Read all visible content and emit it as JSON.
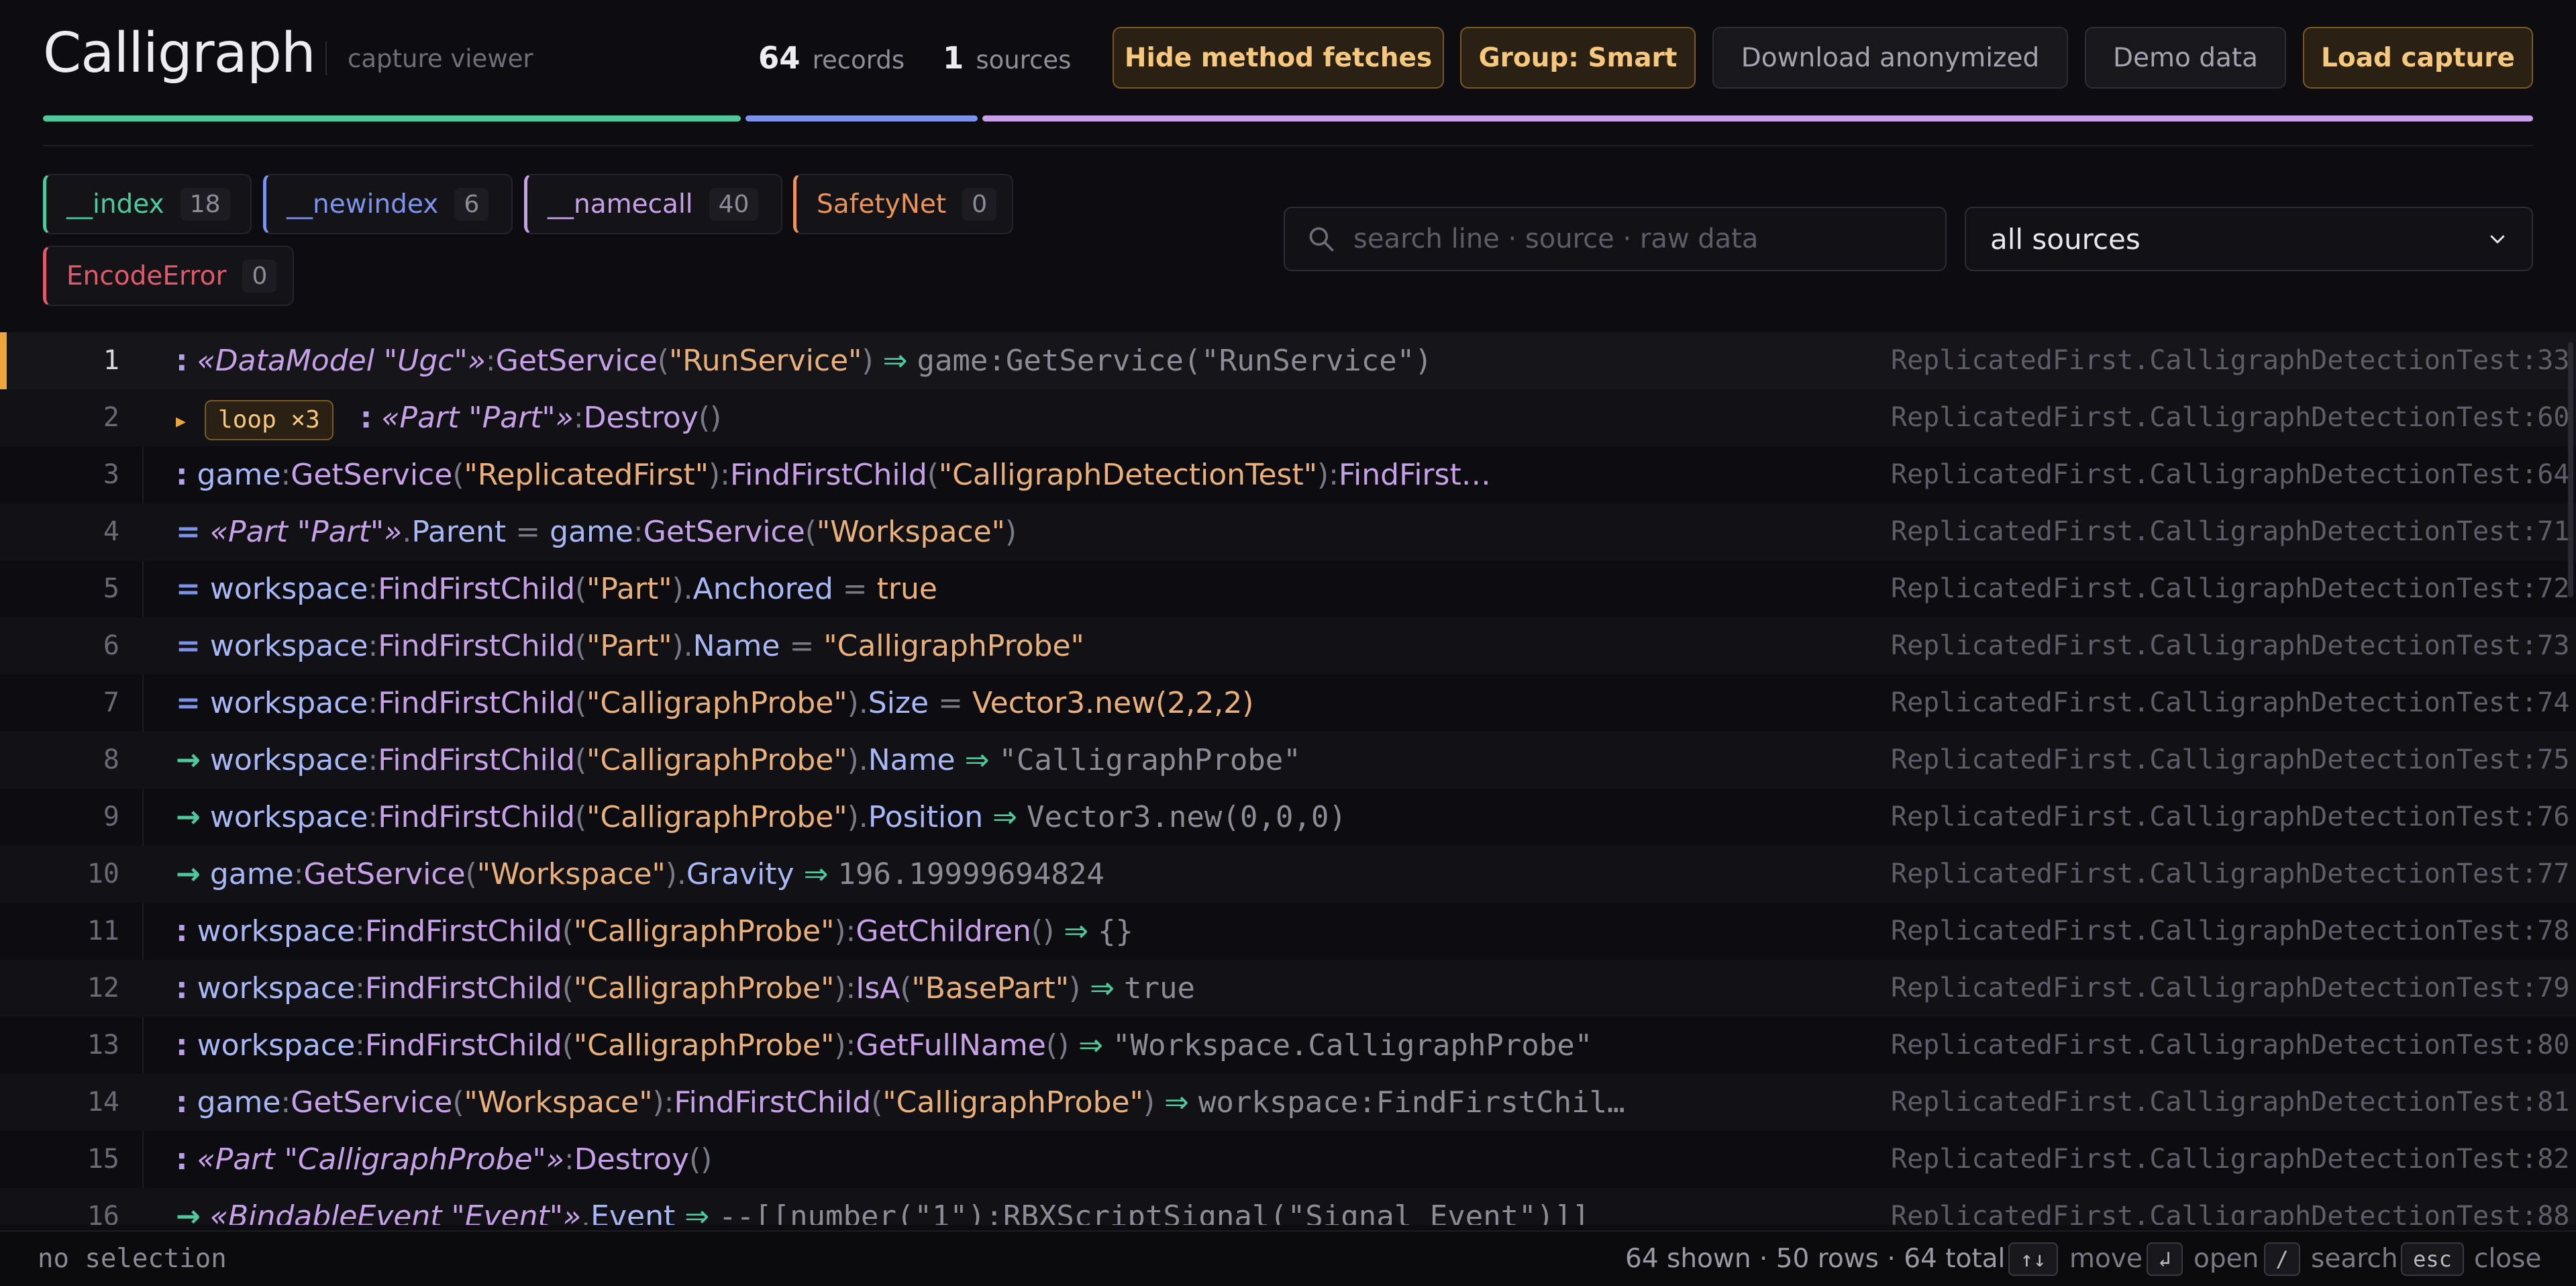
{
  "app": {
    "title": "Calligraph",
    "subtitle": "capture viewer"
  },
  "stats": {
    "records_count": "64",
    "records_label": "records",
    "sources_count": "1",
    "sources_label": "sources"
  },
  "toolbar": {
    "hide_method": "Hide method fetches",
    "group": "Group: Smart",
    "download": "Download anonymized",
    "demo": "Demo data",
    "load": "Load capture"
  },
  "colors": {
    "accent": "#f0a53c",
    "index": "#4fc89c",
    "newindex": "#7b94ea",
    "namecall": "#c7a1e8",
    "safetynet": "#e9945a",
    "encodeerror": "#e05a6a"
  },
  "filters": [
    {
      "label": "__index",
      "count": "18"
    },
    {
      "label": "__newindex",
      "count": "6"
    },
    {
      "label": "__namecall",
      "count": "40"
    },
    {
      "label": "SafetyNet",
      "count": "0"
    },
    {
      "label": "EncodeError",
      "count": "0"
    }
  ],
  "search": {
    "placeholder": "search line · source · raw data",
    "icon": "search-icon"
  },
  "source_select": {
    "value": "all sources"
  },
  "rows": [
    {
      "n": "1",
      "src": "ReplicatedFirst.CalligraphDetectionTest:33"
    },
    {
      "n": "2",
      "loop": "loop ×3",
      "src": "ReplicatedFirst.CalligraphDetectionTest:60"
    },
    {
      "n": "3",
      "src": "ReplicatedFirst.CalligraphDetectionTest:64"
    },
    {
      "n": "4",
      "src": "ReplicatedFirst.CalligraphDetectionTest:71"
    },
    {
      "n": "5",
      "src": "ReplicatedFirst.CalligraphDetectionTest:72"
    },
    {
      "n": "6",
      "src": "ReplicatedFirst.CalligraphDetectionTest:73"
    },
    {
      "n": "7",
      "src": "ReplicatedFirst.CalligraphDetectionTest:74"
    },
    {
      "n": "8",
      "src": "ReplicatedFirst.CalligraphDetectionTest:75"
    },
    {
      "n": "9",
      "src": "ReplicatedFirst.CalligraphDetectionTest:76"
    },
    {
      "n": "10",
      "src": "ReplicatedFirst.CalligraphDetectionTest:77"
    },
    {
      "n": "11",
      "src": "ReplicatedFirst.CalligraphDetectionTest:78"
    },
    {
      "n": "12",
      "src": "ReplicatedFirst.CalligraphDetectionTest:79"
    },
    {
      "n": "13",
      "src": "ReplicatedFirst.CalligraphDetectionTest:80"
    },
    {
      "n": "14",
      "src": "ReplicatedFirst.CalligraphDetectionTest:81"
    },
    {
      "n": "15",
      "src": "ReplicatedFirst.CalligraphDetectionTest:82"
    },
    {
      "n": "16",
      "src": "ReplicatedFirst.CalligraphDetectionTest:88"
    }
  ],
  "code": {
    "ws": "workspace",
    "game": "game",
    "gs": "GetService",
    "ffc": "FindFirstChild",
    "ffc_trunc": "FindFirst…",
    "s_run": "\"RunService\"",
    "s_rep": "\"ReplicatedFirst\"",
    "s_cdt": "\"CalligraphDetectionTest\"",
    "s_ws": "\"Workspace\"",
    "s_part": "\"Part\"",
    "s_probe": "\"CalligraphProbe\"",
    "s_basepart": "\"BasePart\"",
    "dm_ugc": "«DataModel \"Ugc\"»",
    "part_part": "«Part \"Part\"»",
    "part_probe": "«Part \"CalligraphProbe\"»",
    "bind_event": "«BindableEvent \"Event\"»",
    "destroy": "Destroy",
    "parent": "Parent",
    "anchored": "Anchored",
    "name": "Name",
    "size": "Size",
    "position": "Position",
    "gravity": "Gravity",
    "getchildren": "GetChildren",
    "isa": "IsA",
    "getfullname": "GetFullName",
    "event": "Event",
    "v_true": "true",
    "v_probe": "\"CalligraphProbe\"",
    "v_size": "Vector3.new(2,2,2)",
    "r1": "game:GetService(\"RunService\")",
    "r8": "\"CalligraphProbe\"",
    "r9": "Vector3.new(0,0,0)",
    "r10": "196.19999694824",
    "r11": "{}",
    "r12": "true",
    "r13": "\"Workspace.CalligraphProbe\"",
    "r14": "workspace:FindFirstChil…",
    "r16": "--[[number(\"1\"):RBXScriptSignal(\"Signal Event\")]]"
  },
  "footer": {
    "selection": "no selection",
    "counts": "64 shown · 50 rows · 64 total",
    "k_move": "↑↓",
    "l_move": "move",
    "k_open": "↲",
    "l_open": "open",
    "k_search": "/",
    "l_search": "search",
    "k_close": "esc",
    "l_close": "close"
  }
}
